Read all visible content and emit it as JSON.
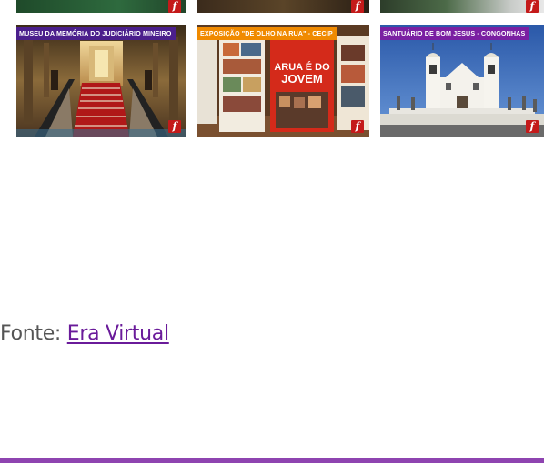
{
  "colors": {
    "label_purple": "#4b1f8c",
    "label_orange": "#f08a00",
    "label_violet": "#7a1fa2",
    "flash_red": "#c41a1a",
    "link_purple": "#6a1b9a",
    "footer_purple": "#8e44b0"
  },
  "gallery": {
    "top_row": [
      {
        "icon": "flash-icon",
        "badge": "f"
      },
      {
        "icon": "flash-icon",
        "badge": "f"
      },
      {
        "icon": "flash-icon",
        "badge": "f"
      }
    ],
    "tiles": [
      {
        "label": "MUSEU DA MEMÓRIA DO JUDICIÁRIO MINEIRO",
        "label_color": "#4b1f8c",
        "badge": "f"
      },
      {
        "label": "EXPOSIÇÃO \"DE OLHO NA RUA\" - CECIP",
        "label_color": "#f08a00",
        "badge": "f",
        "poster_text": "ARUA É DO JOVEM"
      },
      {
        "label": "SANTUÁRIO DE BOM JESUS - CONGONHAS",
        "label_color": "#7a1fa2",
        "badge": "f"
      }
    ]
  },
  "source": {
    "prefix": "Fonte: ",
    "link_text": "Era Virtual"
  }
}
